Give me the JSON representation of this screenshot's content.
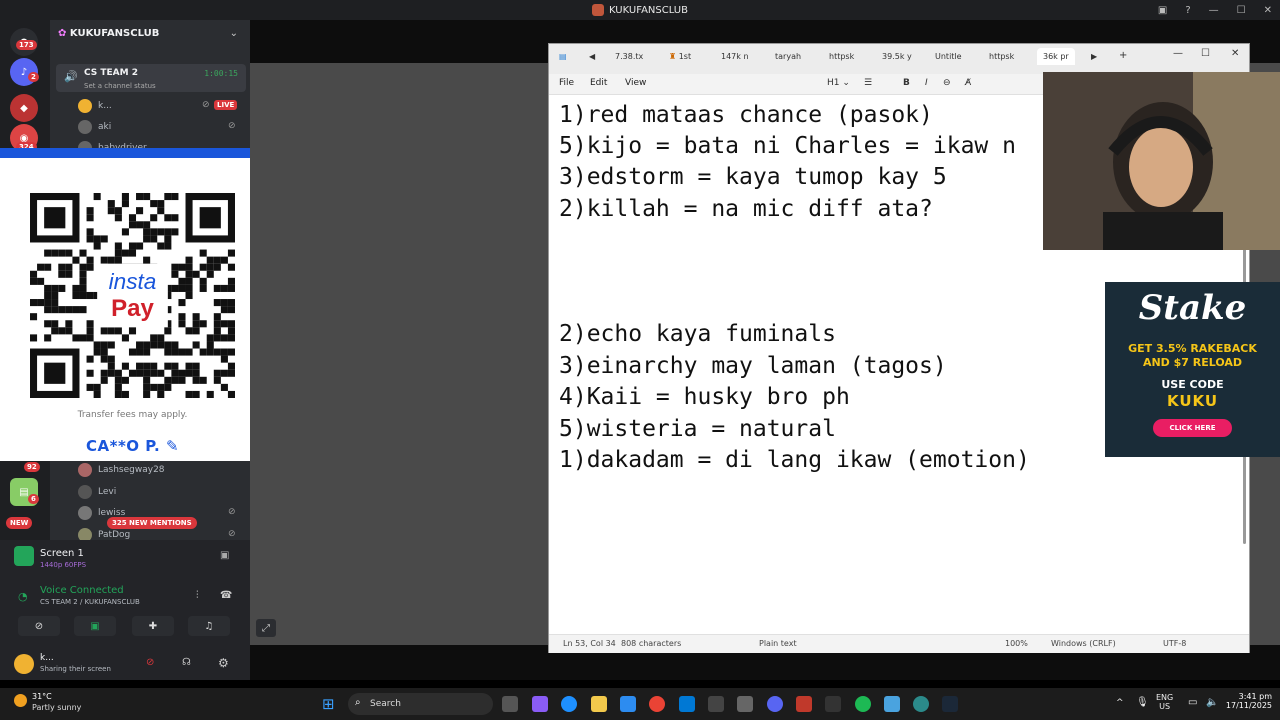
{
  "titlebar": {
    "title": "KUKUFANSCLUB"
  },
  "discord": {
    "server_name": "KUKUFANSCLUB",
    "server_badges": [
      "173",
      "2",
      "324",
      "92",
      "6"
    ],
    "new_label": "NEW",
    "voice_channel": {
      "name": "CS TEAM 2",
      "status": "Set a channel status",
      "timer": "1:00:15"
    },
    "members": [
      {
        "name": "k...",
        "live": "LIVE"
      },
      {
        "name": "aki"
      },
      {
        "name": "babydriver"
      },
      {
        "name": "Lashsegway28"
      },
      {
        "name": "Levi"
      },
      {
        "name": "lewiss"
      },
      {
        "name": "PatDog"
      }
    ],
    "new_mentions": "325 NEW MENTIONS",
    "stream": {
      "title": "Screen 1",
      "quality": "1440p 60FPS"
    },
    "voice": {
      "status": "Voice Connected",
      "location": "CS TEAM 2 / KUKUFANSCLUB"
    },
    "user": {
      "name": "k...",
      "activity": "Sharing their screen"
    }
  },
  "qr": {
    "brand_top": "insta",
    "brand_bottom": "Pay",
    "fees": "Transfer fees may apply.",
    "payee": "CA**O P."
  },
  "notepad": {
    "tabs": [
      "7.38.tx",
      "1st",
      "147k n",
      "taryah",
      "httpsk",
      "39.5k y",
      "Untitle",
      "httpsk",
      "36k pr"
    ],
    "menu": [
      "File",
      "Edit",
      "View"
    ],
    "heading": "H1",
    "lines": [
      "1)red mataas chance (pasok)",
      "5)kijo = bata ni Charles = ikaw n",
      "3)edstorm = kaya tumop kay 5",
      "2)killah = na mic diff ata?",
      "2)echo kaya fuminals",
      "3)einarchy may laman (tagos)",
      "4)Kaii = husky bro ph",
      "5)wisteria = natural",
      "1)dakadam = di lang ikaw (emotion)"
    ],
    "status": {
      "position": "Ln 53, Col 34",
      "chars": "808 characters",
      "mode": "Plain text",
      "zoom": "100%",
      "eol": "Windows (CRLF)",
      "encoding": "UTF-8"
    }
  },
  "ad": {
    "brand": "Stake",
    "line1": "GET 3.5% RAKEBACK",
    "line2": "AND $7 RELOAD",
    "line3": "USE CODE",
    "code": "KUKU",
    "button": "CLICK HERE"
  },
  "taskbar": {
    "temp": "31°C",
    "weather": "Partly sunny",
    "search_placeholder": "Search",
    "lang": "ENG",
    "region": "US",
    "time": "3:41 pm",
    "date": "17/11/2025"
  }
}
